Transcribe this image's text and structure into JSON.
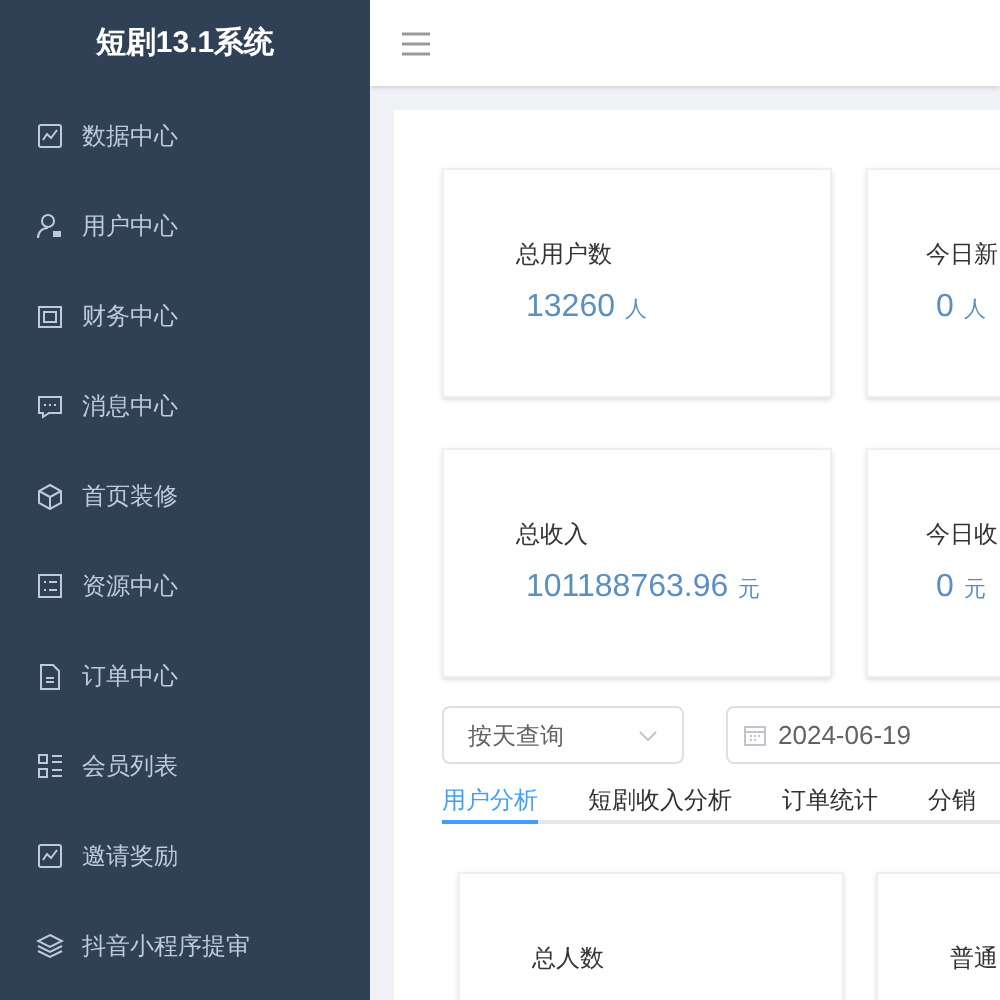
{
  "sidebar": {
    "title": "短剧13.1系统",
    "items": [
      {
        "label": "数据中心",
        "kind": "chart"
      },
      {
        "label": "用户中心",
        "kind": "user"
      },
      {
        "label": "财务中心",
        "kind": "wallet"
      },
      {
        "label": "消息中心",
        "kind": "message"
      },
      {
        "label": "首页装修",
        "kind": "box"
      },
      {
        "label": "资源中心",
        "kind": "list"
      },
      {
        "label": "订单中心",
        "kind": "document"
      },
      {
        "label": "会员列表",
        "kind": "grid"
      },
      {
        "label": "邀请奖励",
        "kind": "chart"
      },
      {
        "label": "抖音小程序提审",
        "kind": "layers"
      }
    ]
  },
  "stats": [
    {
      "label": "总用户数",
      "value": "13260",
      "unit": "人"
    },
    {
      "label": "今日新",
      "value": "0",
      "unit": "人"
    },
    {
      "label": "总收入",
      "value": "101188763.96",
      "unit": "元"
    },
    {
      "label": "今日收",
      "value": "0",
      "unit": "元"
    }
  ],
  "filters": {
    "period": "按天查询",
    "date": "2024-06-19"
  },
  "tabs": [
    {
      "label": "用户分析",
      "selected": true
    },
    {
      "label": "短剧收入分析",
      "selected": false
    },
    {
      "label": "订单统计",
      "selected": false
    },
    {
      "label": "分销",
      "selected": false
    }
  ],
  "analysis_cards": [
    {
      "label": "总人数"
    },
    {
      "label": "普通"
    }
  ]
}
